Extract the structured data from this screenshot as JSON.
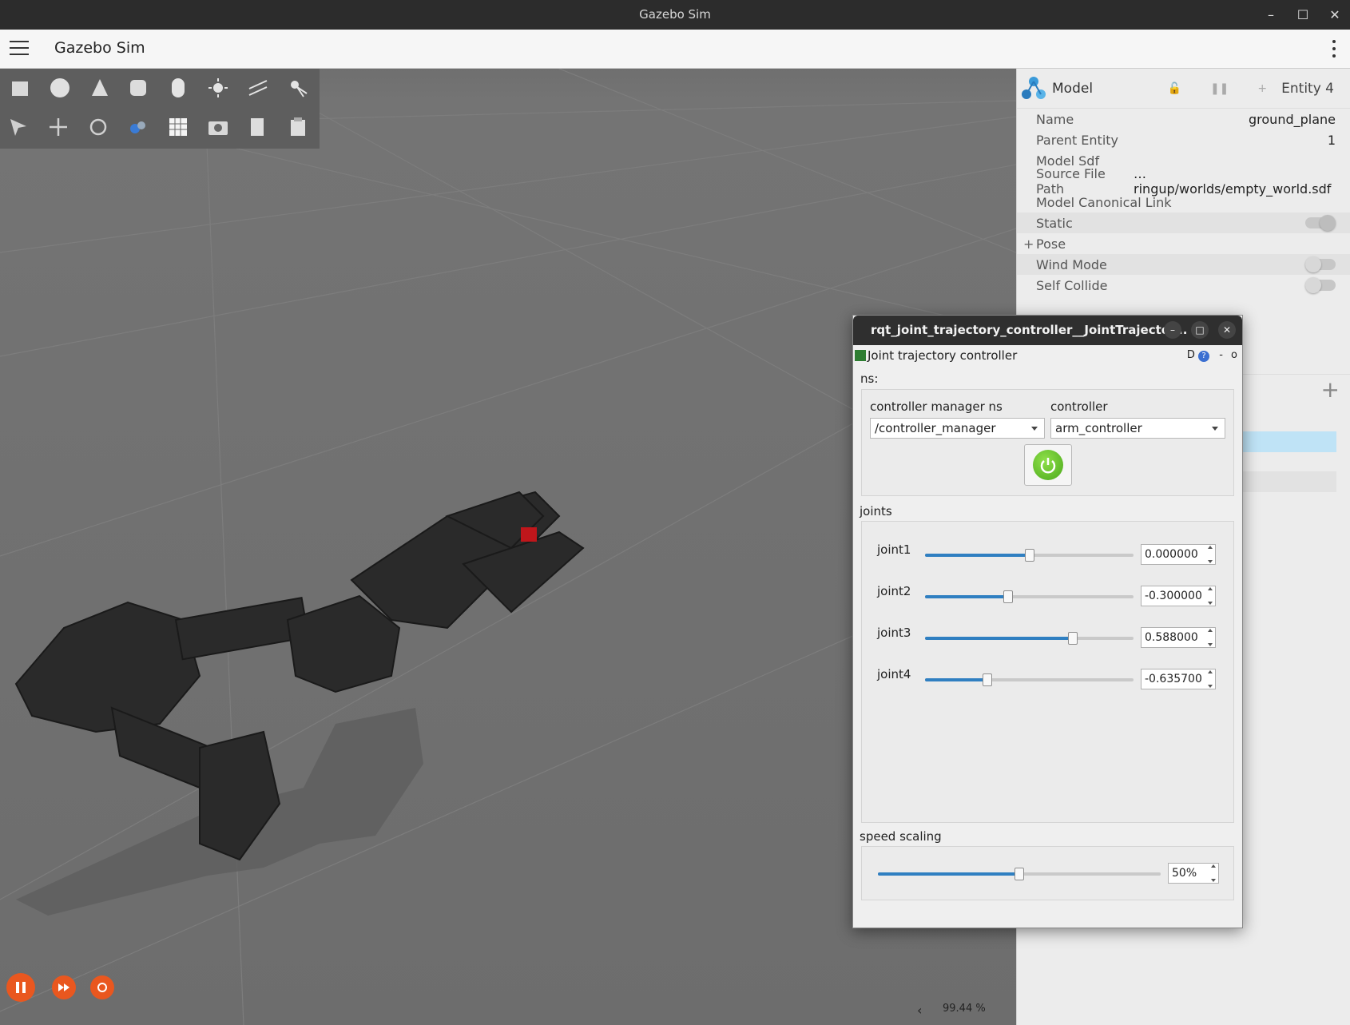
{
  "window": {
    "title": "Gazebo Sim"
  },
  "app": {
    "title": "Gazebo Sim"
  },
  "component_inspector": {
    "title": "Model",
    "entity": "Entity 4",
    "rows": [
      {
        "label": "Name",
        "value": "ground_plane"
      },
      {
        "label": "Parent Entity",
        "value": "1"
      },
      {
        "label": "Model Sdf",
        "value": ""
      },
      {
        "label": "Source File Path",
        "value": "…ringup/worlds/empty_world.sdf"
      },
      {
        "label": "Model Canonical Link",
        "value": ""
      }
    ],
    "static_label": "Static",
    "pose_label": "Pose",
    "wind_label": "Wind Mode",
    "collide_label": "Self Collide"
  },
  "rqt": {
    "title": "rqt_joint_trajectory_controller__JointTrajector...",
    "plugin_title": "Joint trajectory controller",
    "plugin_right": "D",
    "ns_label": "ns:",
    "cm_ns_label": "controller manager ns",
    "controller_label": "controller",
    "cm_ns_value": "/controller_manager",
    "controller_value": "arm_controller",
    "joints_label": "joints",
    "joints": [
      {
        "name": "joint1",
        "value": "0.000000",
        "position": 0.5
      },
      {
        "name": "joint2",
        "value": "-0.300000",
        "position": 0.4
      },
      {
        "name": "joint3",
        "value": "0.588000",
        "position": 0.71
      },
      {
        "name": "joint4",
        "value": "-0.635700",
        "position": 0.3
      }
    ],
    "speed_label": "speed scaling",
    "speed_value": "50%",
    "speed_position": 0.5
  },
  "status": {
    "rtf": "99.44 %"
  },
  "colors": {
    "accent": "#2f7fc1",
    "play": "#e9571f",
    "power": "#5cbf2a"
  }
}
